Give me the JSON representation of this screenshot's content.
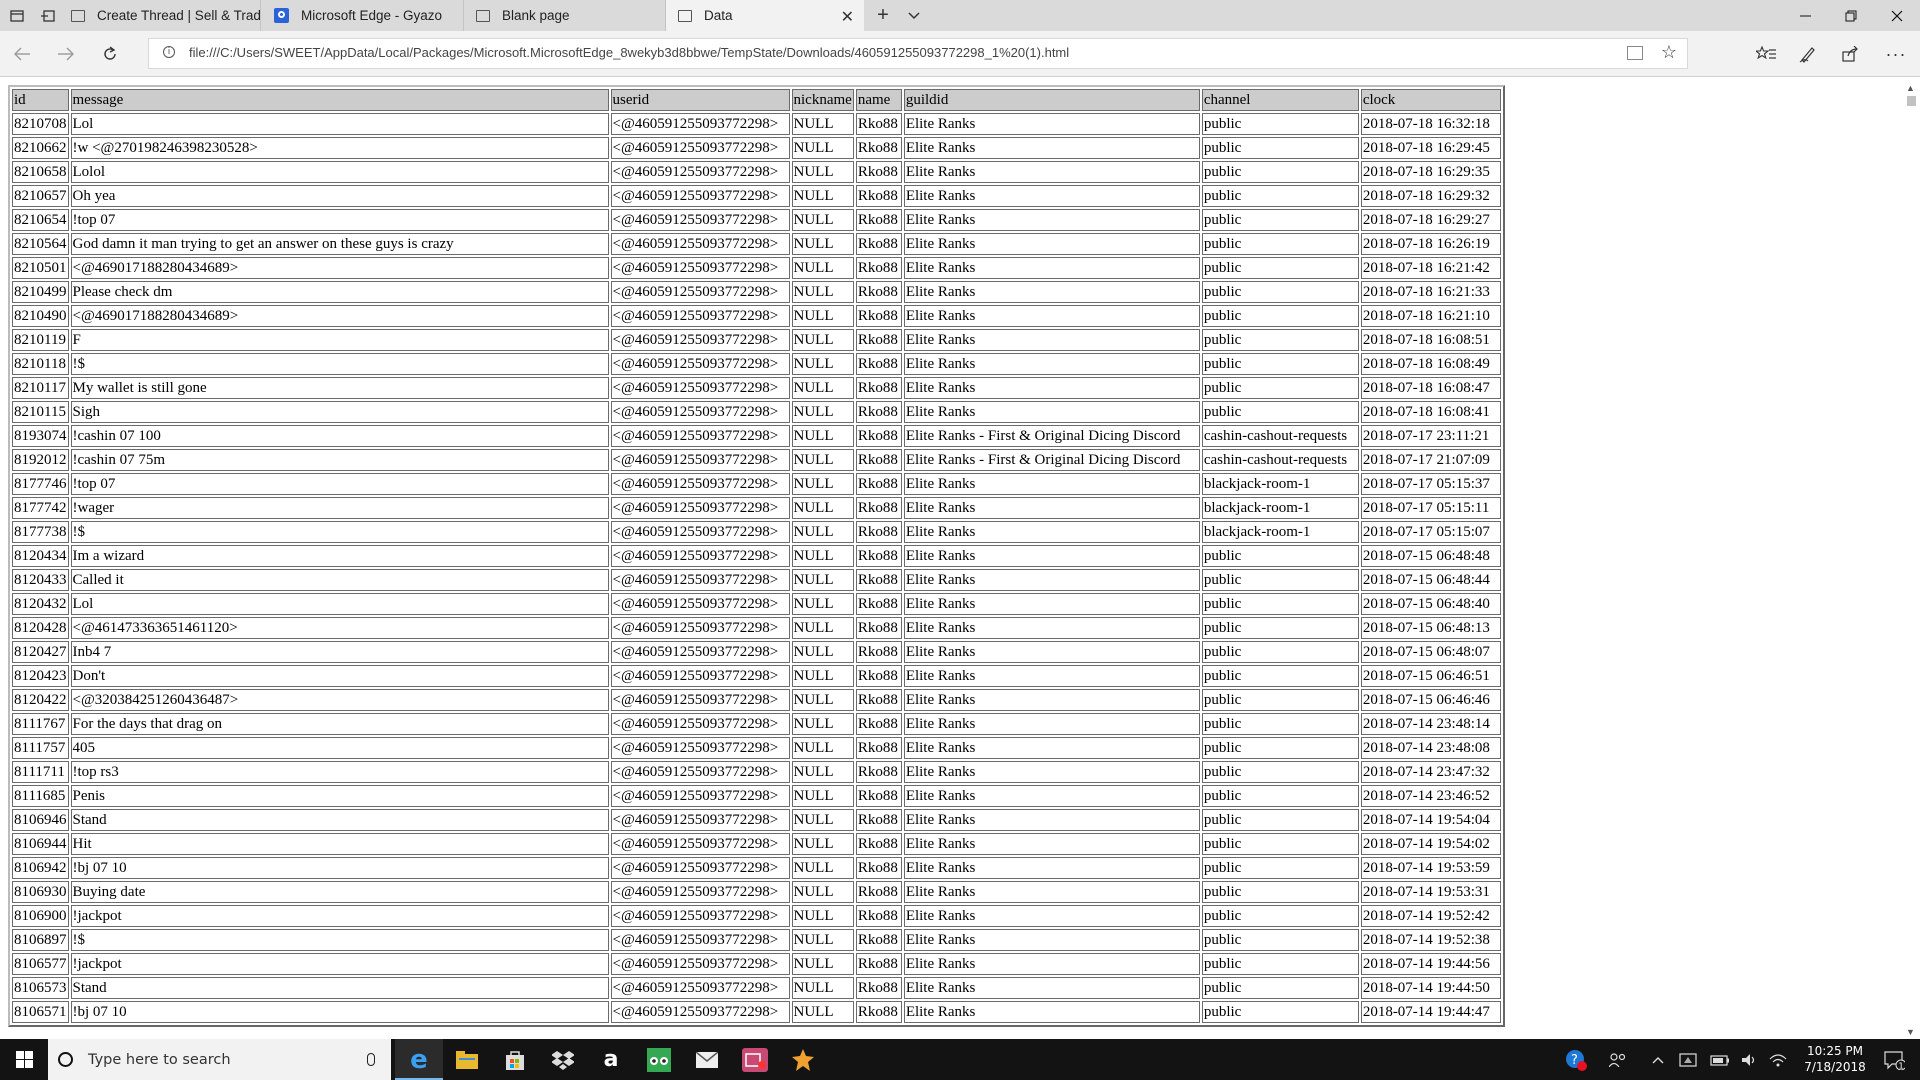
{
  "browser": {
    "tabs": [
      {
        "title": "Create Thread | Sell & Trade"
      },
      {
        "title": "Microsoft Edge - Gyazo"
      },
      {
        "title": "Blank page"
      },
      {
        "title": "Data"
      }
    ],
    "new_tab": "+",
    "url": "file:///C:/Users/SWEET/AppData/Local/Packages/Microsoft.MicrosoftEdge_8wekyb3d8bbwe/TempState/Downloads/460591255093772298_1%20(1).html"
  },
  "table": {
    "columns": [
      "id",
      "message",
      "userid",
      "nickname",
      "name",
      "guildid",
      "channel",
      "clock"
    ],
    "rows": [
      [
        "8210708",
        "Lol",
        "<@460591255093772298>",
        "NULL",
        "Rko88",
        "Elite Ranks",
        "public",
        "2018-07-18 16:32:18"
      ],
      [
        "8210662",
        "!w <@270198246398230528>",
        "<@460591255093772298>",
        "NULL",
        "Rko88",
        "Elite Ranks",
        "public",
        "2018-07-18 16:29:45"
      ],
      [
        "8210658",
        "Lolol",
        "<@460591255093772298>",
        "NULL",
        "Rko88",
        "Elite Ranks",
        "public",
        "2018-07-18 16:29:35"
      ],
      [
        "8210657",
        "Oh yea",
        "<@460591255093772298>",
        "NULL",
        "Rko88",
        "Elite Ranks",
        "public",
        "2018-07-18 16:29:32"
      ],
      [
        "8210654",
        "!top 07",
        "<@460591255093772298>",
        "NULL",
        "Rko88",
        "Elite Ranks",
        "public",
        "2018-07-18 16:29:27"
      ],
      [
        "8210564",
        "God damn it man trying to get an answer on these guys is crazy",
        "<@460591255093772298>",
        "NULL",
        "Rko88",
        "Elite Ranks",
        "public",
        "2018-07-18 16:26:19"
      ],
      [
        "8210501",
        "<@469017188280434689>",
        "<@460591255093772298>",
        "NULL",
        "Rko88",
        "Elite Ranks",
        "public",
        "2018-07-18 16:21:42"
      ],
      [
        "8210499",
        "Please check dm",
        "<@460591255093772298>",
        "NULL",
        "Rko88",
        "Elite Ranks",
        "public",
        "2018-07-18 16:21:33"
      ],
      [
        "8210490",
        "<@469017188280434689>",
        "<@460591255093772298>",
        "NULL",
        "Rko88",
        "Elite Ranks",
        "public",
        "2018-07-18 16:21:10"
      ],
      [
        "8210119",
        "F",
        "<@460591255093772298>",
        "NULL",
        "Rko88",
        "Elite Ranks",
        "public",
        "2018-07-18 16:08:51"
      ],
      [
        "8210118",
        "!$",
        "<@460591255093772298>",
        "NULL",
        "Rko88",
        "Elite Ranks",
        "public",
        "2018-07-18 16:08:49"
      ],
      [
        "8210117",
        "My wallet is still gone",
        "<@460591255093772298>",
        "NULL",
        "Rko88",
        "Elite Ranks",
        "public",
        "2018-07-18 16:08:47"
      ],
      [
        "8210115",
        "Sigh",
        "<@460591255093772298>",
        "NULL",
        "Rko88",
        "Elite Ranks",
        "public",
        "2018-07-18 16:08:41"
      ],
      [
        "8193074",
        "!cashin 07 100",
        "<@460591255093772298>",
        "NULL",
        "Rko88",
        "Elite Ranks - First & Original Dicing Discord",
        "cashin-cashout-requests",
        "2018-07-17 23:11:21"
      ],
      [
        "8192012",
        "!cashin 07 75m",
        "<@460591255093772298>",
        "NULL",
        "Rko88",
        "Elite Ranks - First & Original Dicing Discord",
        "cashin-cashout-requests",
        "2018-07-17 21:07:09"
      ],
      [
        "8177746",
        "!top 07",
        "<@460591255093772298>",
        "NULL",
        "Rko88",
        "Elite Ranks",
        "blackjack-room-1",
        "2018-07-17 05:15:37"
      ],
      [
        "8177742",
        "!wager",
        "<@460591255093772298>",
        "NULL",
        "Rko88",
        "Elite Ranks",
        "blackjack-room-1",
        "2018-07-17 05:15:11"
      ],
      [
        "8177738",
        "!$",
        "<@460591255093772298>",
        "NULL",
        "Rko88",
        "Elite Ranks",
        "blackjack-room-1",
        "2018-07-17 05:15:07"
      ],
      [
        "8120434",
        "Im a wizard",
        "<@460591255093772298>",
        "NULL",
        "Rko88",
        "Elite Ranks",
        "public",
        "2018-07-15 06:48:48"
      ],
      [
        "8120433",
        "Called it",
        "<@460591255093772298>",
        "NULL",
        "Rko88",
        "Elite Ranks",
        "public",
        "2018-07-15 06:48:44"
      ],
      [
        "8120432",
        "Lol",
        "<@460591255093772298>",
        "NULL",
        "Rko88",
        "Elite Ranks",
        "public",
        "2018-07-15 06:48:40"
      ],
      [
        "8120428",
        "<@461473363651461120>",
        "<@460591255093772298>",
        "NULL",
        "Rko88",
        "Elite Ranks",
        "public",
        "2018-07-15 06:48:13"
      ],
      [
        "8120427",
        "Inb4 7",
        "<@460591255093772298>",
        "NULL",
        "Rko88",
        "Elite Ranks",
        "public",
        "2018-07-15 06:48:07"
      ],
      [
        "8120423",
        "Don't",
        "<@460591255093772298>",
        "NULL",
        "Rko88",
        "Elite Ranks",
        "public",
        "2018-07-15 06:46:51"
      ],
      [
        "8120422",
        "<@320384251260436487>",
        "<@460591255093772298>",
        "NULL",
        "Rko88",
        "Elite Ranks",
        "public",
        "2018-07-15 06:46:46"
      ],
      [
        "8111767",
        "For the days that drag on",
        "<@460591255093772298>",
        "NULL",
        "Rko88",
        "Elite Ranks",
        "public",
        "2018-07-14 23:48:14"
      ],
      [
        "8111757",
        "405",
        "<@460591255093772298>",
        "NULL",
        "Rko88",
        "Elite Ranks",
        "public",
        "2018-07-14 23:48:08"
      ],
      [
        "8111711",
        "!top rs3",
        "<@460591255093772298>",
        "NULL",
        "Rko88",
        "Elite Ranks",
        "public",
        "2018-07-14 23:47:32"
      ],
      [
        "8111685",
        "Penis",
        "<@460591255093772298>",
        "NULL",
        "Rko88",
        "Elite Ranks",
        "public",
        "2018-07-14 23:46:52"
      ],
      [
        "8106946",
        "Stand",
        "<@460591255093772298>",
        "NULL",
        "Rko88",
        "Elite Ranks",
        "public",
        "2018-07-14 19:54:04"
      ],
      [
        "8106944",
        "Hit",
        "<@460591255093772298>",
        "NULL",
        "Rko88",
        "Elite Ranks",
        "public",
        "2018-07-14 19:54:02"
      ],
      [
        "8106942",
        "!bj 07 10",
        "<@460591255093772298>",
        "NULL",
        "Rko88",
        "Elite Ranks",
        "public",
        "2018-07-14 19:53:59"
      ],
      [
        "8106930",
        "Buying date",
        "<@460591255093772298>",
        "NULL",
        "Rko88",
        "Elite Ranks",
        "public",
        "2018-07-14 19:53:31"
      ],
      [
        "8106900",
        "!jackpot",
        "<@460591255093772298>",
        "NULL",
        "Rko88",
        "Elite Ranks",
        "public",
        "2018-07-14 19:52:42"
      ],
      [
        "8106897",
        "!$",
        "<@460591255093772298>",
        "NULL",
        "Rko88",
        "Elite Ranks",
        "public",
        "2018-07-14 19:52:38"
      ],
      [
        "8106577",
        "!jackpot",
        "<@460591255093772298>",
        "NULL",
        "Rko88",
        "Elite Ranks",
        "public",
        "2018-07-14 19:44:56"
      ],
      [
        "8106573",
        "Stand",
        "<@460591255093772298>",
        "NULL",
        "Rko88",
        "Elite Ranks",
        "public",
        "2018-07-14 19:44:50"
      ],
      [
        "8106571",
        "!bj 07 10",
        "<@460591255093772298>",
        "NULL",
        "Rko88",
        "Elite Ranks",
        "public",
        "2018-07-14 19:44:47"
      ]
    ]
  },
  "taskbar": {
    "search_placeholder": "Type here to search",
    "time": "10:25 PM",
    "date": "7/18/2018",
    "help_badge": "1"
  }
}
